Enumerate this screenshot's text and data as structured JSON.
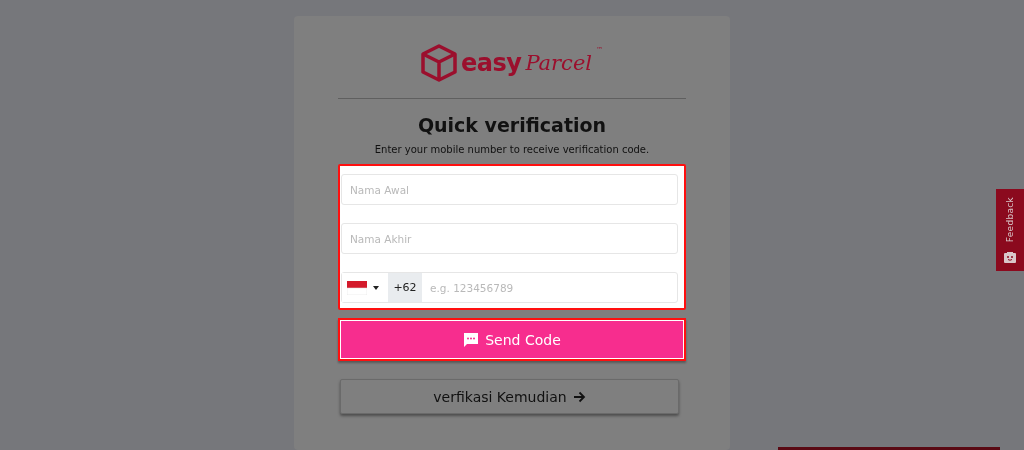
{
  "logo": {
    "brand": "easy",
    "script": "Parcel",
    "mark": "™"
  },
  "title": "Quick verification",
  "subtitle": "Enter your mobile number to receive verification code.",
  "fields": [
    {
      "kind": "text",
      "placeholder": "Nama Awal"
    },
    {
      "kind": "text",
      "placeholder": "Nama Akhir"
    },
    {
      "kind": "phone",
      "dial_code": "+62",
      "placeholder": "e.g. 123456789"
    }
  ],
  "buttons": [
    {
      "kind": "primary",
      "label": "Send Code"
    },
    {
      "kind": "secondary",
      "label": "verfikasi Kemudian"
    }
  ],
  "feedback_tab": {
    "label": "Feedback"
  }
}
